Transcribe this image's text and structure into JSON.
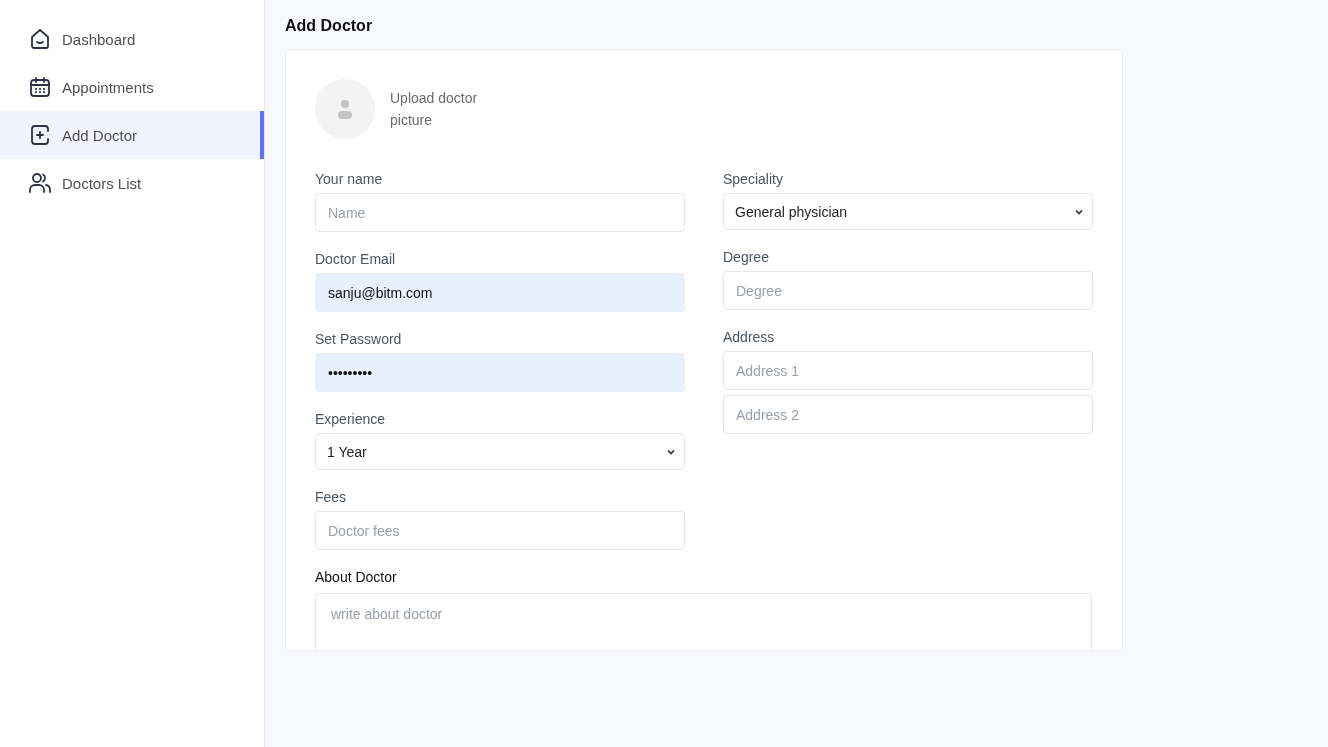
{
  "sidebar": {
    "items": [
      {
        "label": "Dashboard",
        "selected": false
      },
      {
        "label": "Appointments",
        "selected": false
      },
      {
        "label": "Add Doctor",
        "selected": true
      },
      {
        "label": "Doctors List",
        "selected": false
      }
    ]
  },
  "page_title": "Add Doctor",
  "upload": {
    "label": "Upload doctor picture"
  },
  "left_fields": [
    {
      "label": "Your name",
      "kind": "input",
      "placeholder": "Name",
      "autofilled": false
    },
    {
      "label": "Doctor Email",
      "kind": "input",
      "value": "sanju@bitm.com",
      "autofilled": true
    },
    {
      "label": "Set Password",
      "kind": "input",
      "value": "•••••••••",
      "autofilled": true
    },
    {
      "label": "Experience",
      "kind": "select",
      "value": "1 Year"
    },
    {
      "label": "Fees",
      "kind": "input",
      "placeholder": "Doctor fees",
      "autofilled": false
    }
  ],
  "right_fields": [
    {
      "label": "Speciality",
      "kind": "select",
      "value": "General physician"
    },
    {
      "label": "Degree",
      "kind": "input",
      "placeholder": "Degree",
      "autofilled": false
    },
    {
      "label": "Address",
      "kind": "multi",
      "inputs": [
        {
          "placeholder": "Address 1",
          "autofilled": false
        },
        {
          "placeholder": "Address 2",
          "autofilled": false
        }
      ]
    }
  ],
  "about": {
    "label": "About Doctor",
    "placeholder": "write about doctor"
  }
}
